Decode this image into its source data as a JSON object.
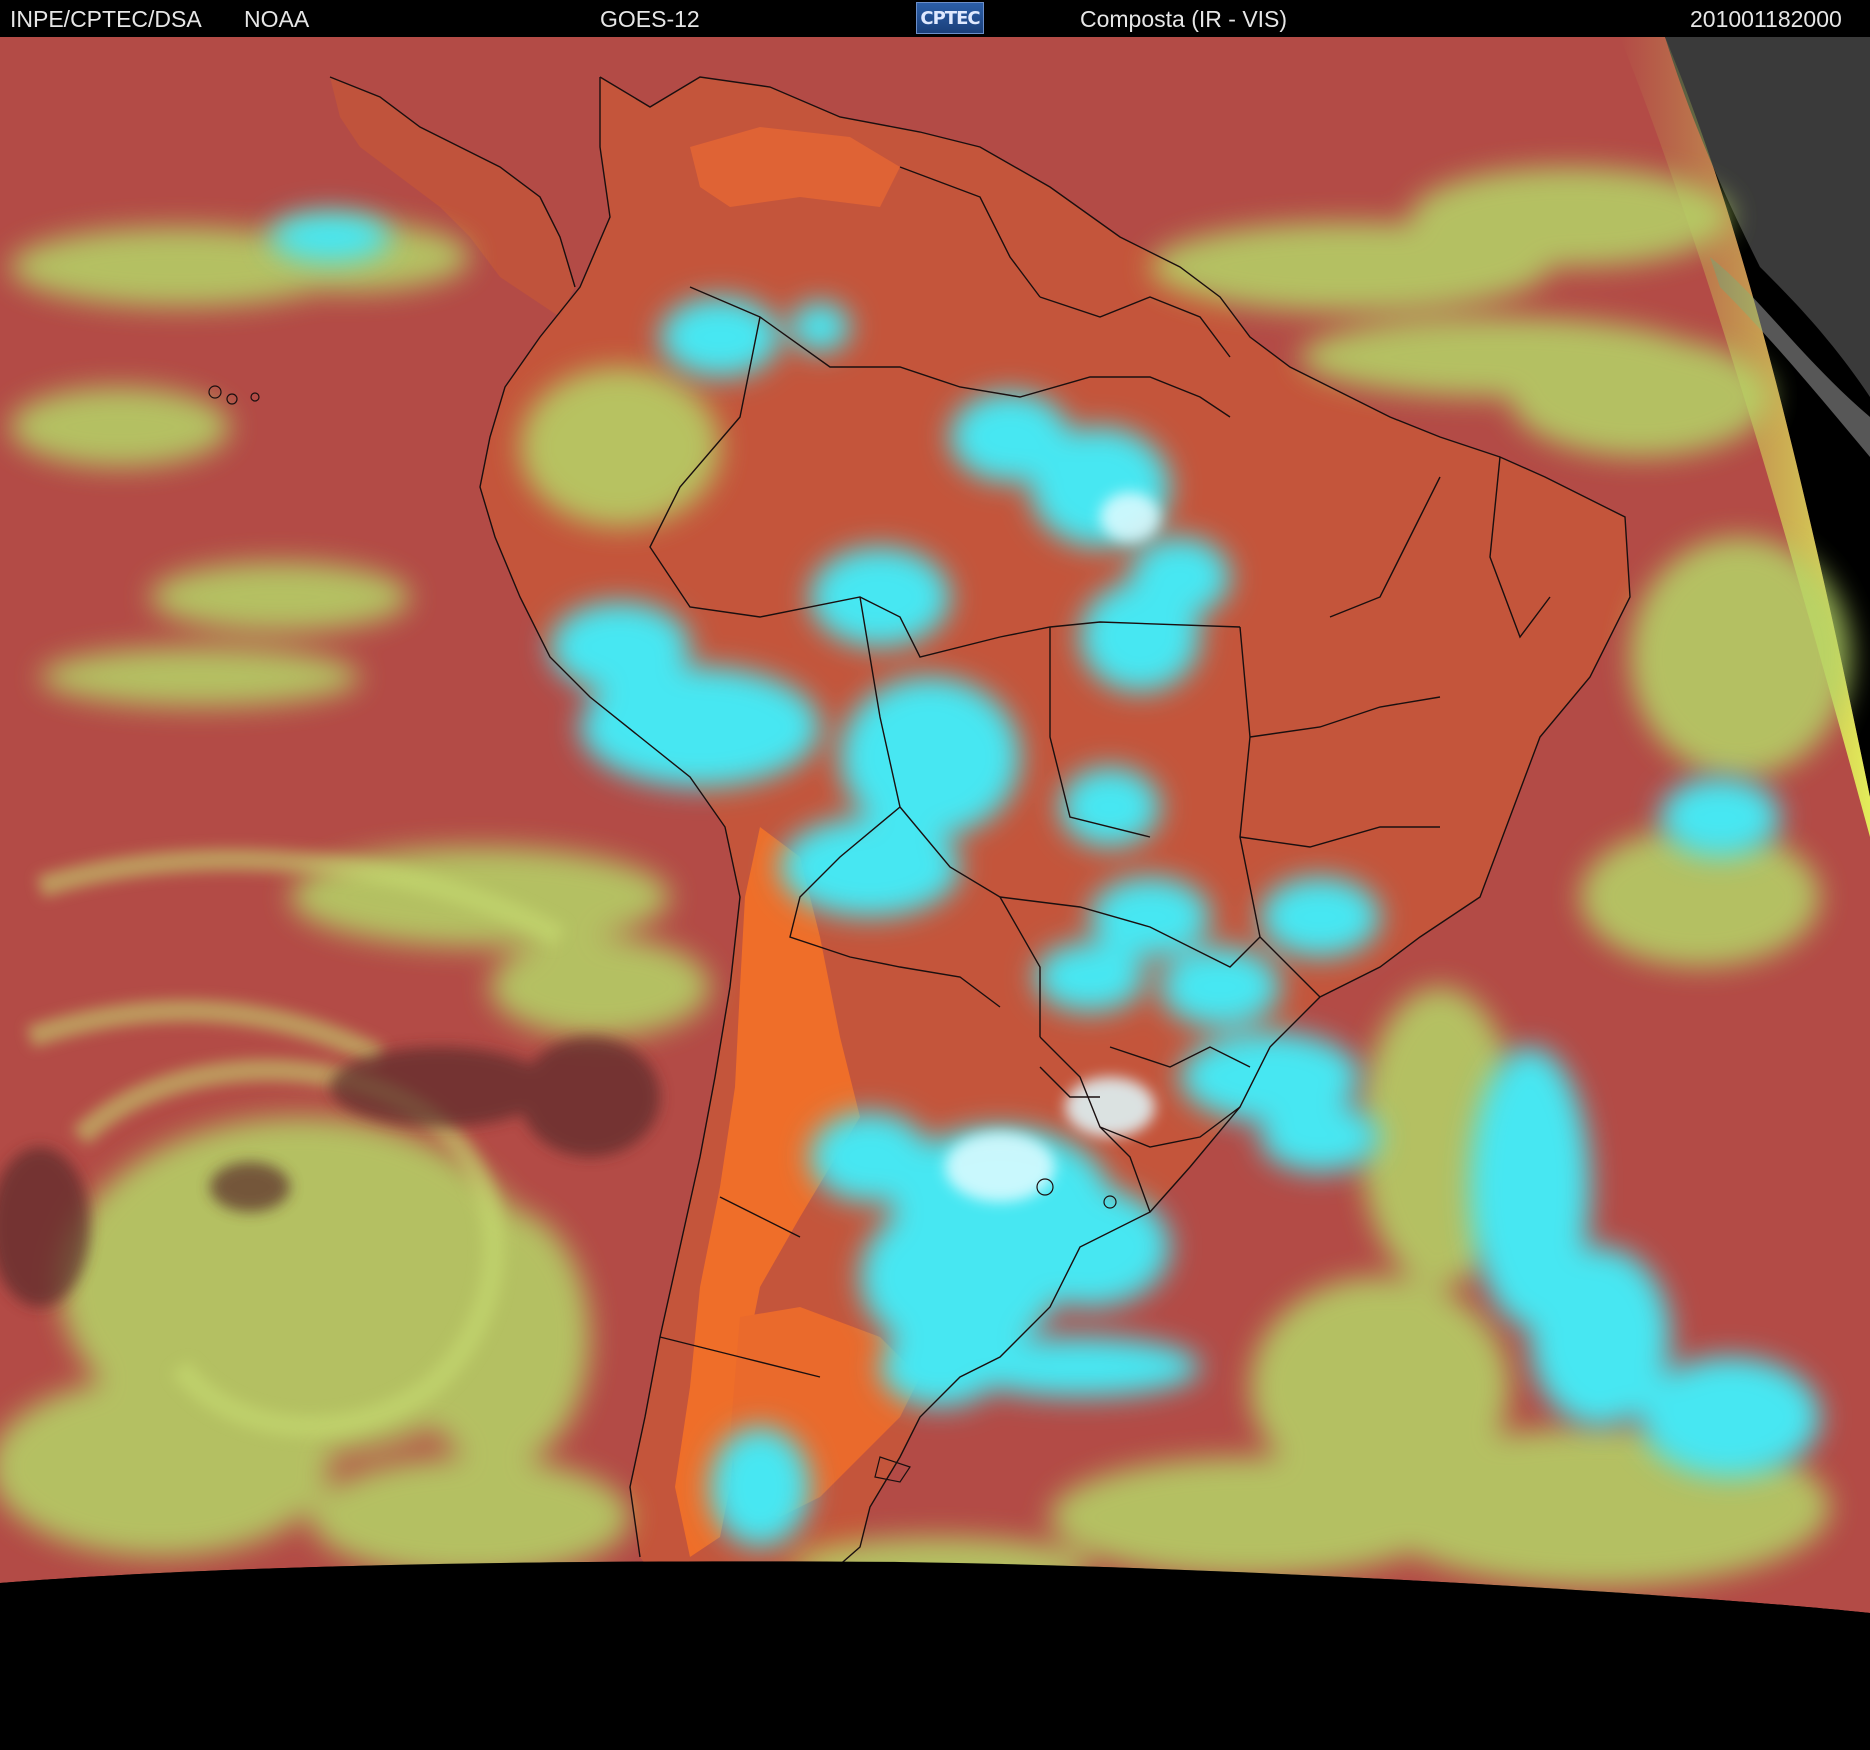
{
  "header": {
    "agency": "INPE/CPTEC/DSA",
    "partner": "NOAA",
    "satellite": "GOES-12",
    "logo_text": "CPTEC",
    "product": "Composta (IR - VIS)",
    "timestamp": "201001182000"
  },
  "map": {
    "colors": {
      "ocean": "#b44a45",
      "land_clear": "#c0533c",
      "desert": "#ea6b2b",
      "low_cloud": "#b7d86a",
      "high_cloud": "#3fe6f0",
      "space": "#000000",
      "limb": "#d8ff5a",
      "border": "#1a0f0f"
    },
    "icons": [
      "border-lines",
      "cloud-fields"
    ]
  }
}
